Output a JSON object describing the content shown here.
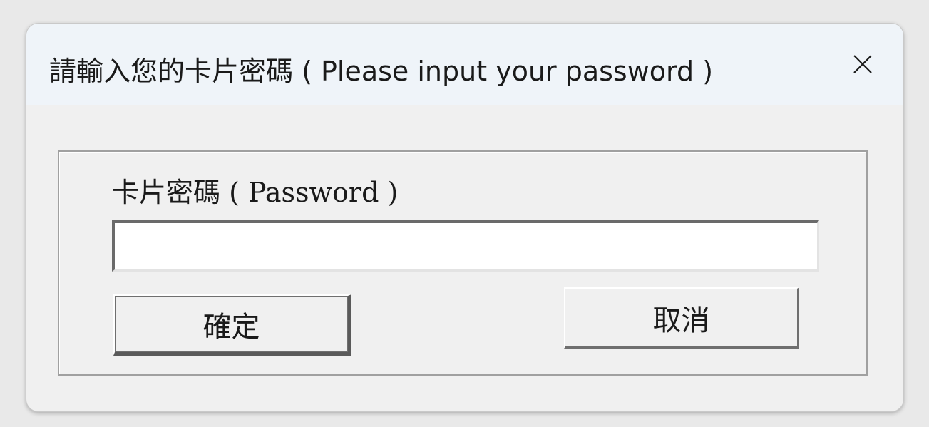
{
  "dialog": {
    "title": "請輸入您的卡片密碼 ( Please input your password )",
    "close_icon": "close-icon"
  },
  "form": {
    "password_label": "卡片密碼 ( Password )",
    "password_value": "",
    "password_placeholder": ""
  },
  "buttons": {
    "ok_label": "確定",
    "cancel_label": "取消"
  },
  "colors": {
    "window_bg": "#f0f0f0",
    "titlebar_bg": "#eff4f9",
    "input_bg": "#ffffff"
  }
}
